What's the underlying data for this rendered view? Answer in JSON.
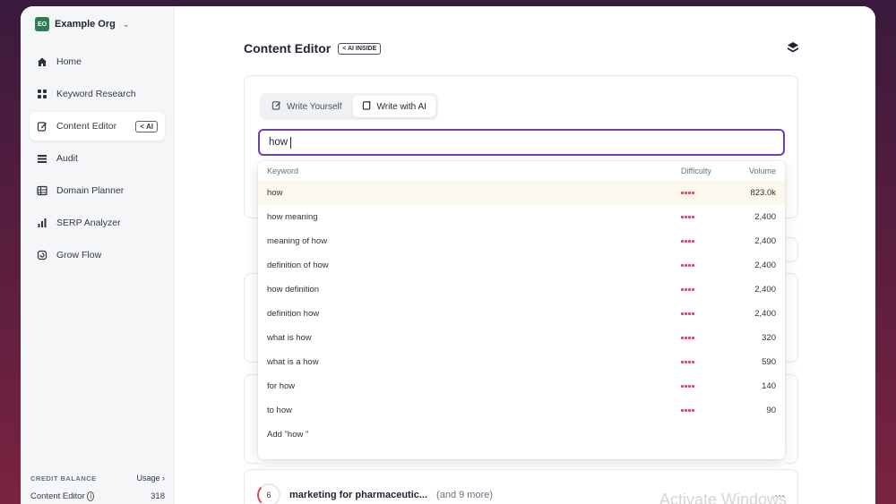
{
  "org": {
    "badge": "EO",
    "name": "Example Org"
  },
  "nav": [
    {
      "label": "Home",
      "icon": "home-icon"
    },
    {
      "label": "Keyword Research",
      "icon": "grid-icon"
    },
    {
      "label": "Content Editor",
      "icon": "edit-icon",
      "tag": "< AI",
      "active": true
    },
    {
      "label": "Audit",
      "icon": "list-icon"
    },
    {
      "label": "Domain Planner",
      "icon": "table-icon"
    },
    {
      "label": "SERP Analyzer",
      "icon": "bar-chart-icon"
    },
    {
      "label": "Grow Flow",
      "icon": "flow-icon"
    }
  ],
  "credit": {
    "title": "CREDIT BALANCE",
    "usage": "Usage ›",
    "row_label": "Content Editor",
    "row_value": "318"
  },
  "header": {
    "title": "Content Editor",
    "ai_badge": "< AI INSIDE"
  },
  "tabs": [
    {
      "label": "Write Yourself",
      "active": false
    },
    {
      "label": "Write with AI",
      "active": true
    }
  ],
  "search": {
    "value": "how"
  },
  "dropdown": {
    "col_keyword": "Keyword",
    "col_difficulty": "Difficulty",
    "col_volume": "Volume",
    "rows": [
      {
        "keyword": "how",
        "volume": "823.0k"
      },
      {
        "keyword": "how meaning",
        "volume": "2,400"
      },
      {
        "keyword": "meaning of how",
        "volume": "2,400"
      },
      {
        "keyword": "definition of how",
        "volume": "2,400"
      },
      {
        "keyword": "how definition",
        "volume": "2,400"
      },
      {
        "keyword": "definition how",
        "volume": "2,400"
      },
      {
        "keyword": "what is how",
        "volume": "320"
      },
      {
        "keyword": "what is a how",
        "volume": "590"
      },
      {
        "keyword": "for how",
        "volume": "140"
      },
      {
        "keyword": "to how",
        "volume": "90"
      }
    ],
    "add_label": "Add \"how \""
  },
  "document": {
    "score": "6",
    "title": "marketing for pharmaceutic...",
    "more": "(and 9 more)"
  },
  "watermark": "Activate Windows",
  "colors": {
    "accent": "#6c3fb5",
    "difficulty": "#e0455c",
    "org": "#2e7d55"
  }
}
